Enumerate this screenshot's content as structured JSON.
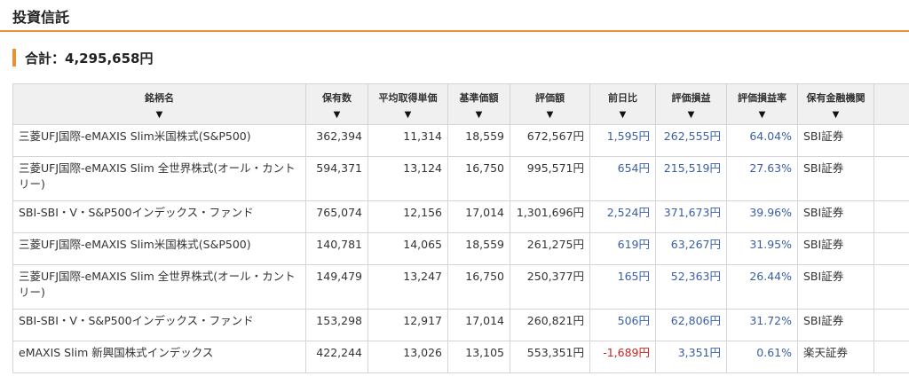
{
  "section": {
    "title": "投資信託"
  },
  "total": {
    "label": "合計：",
    "value": "4,295,658円"
  },
  "colors": {
    "accent": "#e8913a",
    "positive": "#3a5fa5",
    "negative": "#cc2222",
    "header_bg": "#f0f0f0"
  },
  "table": {
    "sort_icon": "sort-down-triangle",
    "sort_glyph": "▼",
    "headers": [
      "銘柄名",
      "保有数",
      "平均取得単価",
      "基準価額",
      "評価額",
      "前日比",
      "評価損益",
      "評価損益率",
      "保有金融機関"
    ],
    "rows": [
      {
        "name": "三菱UFJ国際-eMAXIS Slim米国株式(S&P500)",
        "holdings": "362,394",
        "avg_cost": "11,314",
        "base_price": "18,559",
        "value": "672,567円",
        "day_change": "1,595円",
        "day_sign": "pos",
        "pl": "262,555円",
        "pl_rate": "64.04%",
        "institution": "SBI証券"
      },
      {
        "name": "三菱UFJ国際-eMAXIS Slim 全世界株式(オール・カントリー)",
        "holdings": "594,371",
        "avg_cost": "13,124",
        "base_price": "16,750",
        "value": "995,571円",
        "day_change": "654円",
        "day_sign": "pos",
        "pl": "215,519円",
        "pl_rate": "27.63%",
        "institution": "SBI証券"
      },
      {
        "name": "SBI-SBI・V・S&P500インデックス・ファンド",
        "holdings": "765,074",
        "avg_cost": "12,156",
        "base_price": "17,014",
        "value": "1,301,696円",
        "day_change": "2,524円",
        "day_sign": "pos",
        "pl": "371,673円",
        "pl_rate": "39.96%",
        "institution": "SBI証券"
      },
      {
        "name": "三菱UFJ国際-eMAXIS Slim米国株式(S&P500)",
        "holdings": "140,781",
        "avg_cost": "14,065",
        "base_price": "18,559",
        "value": "261,275円",
        "day_change": "619円",
        "day_sign": "pos",
        "pl": "63,267円",
        "pl_rate": "31.95%",
        "institution": "SBI証券"
      },
      {
        "name": "三菱UFJ国際-eMAXIS Slim 全世界株式(オール・カントリー)",
        "holdings": "149,479",
        "avg_cost": "13,247",
        "base_price": "16,750",
        "value": "250,377円",
        "day_change": "165円",
        "day_sign": "pos",
        "pl": "52,363円",
        "pl_rate": "26.44%",
        "institution": "SBI証券"
      },
      {
        "name": "SBI-SBI・V・S&P500インデックス・ファンド",
        "holdings": "153,298",
        "avg_cost": "12,917",
        "base_price": "17,014",
        "value": "260,821円",
        "day_change": "506円",
        "day_sign": "pos",
        "pl": "62,806円",
        "pl_rate": "31.72%",
        "institution": "SBI証券"
      },
      {
        "name": "eMAXIS Slim 新興国株式インデックス",
        "holdings": "422,244",
        "avg_cost": "13,026",
        "base_price": "13,105",
        "value": "553,351円",
        "day_change": "-1,689円",
        "day_sign": "neg",
        "pl": "3,351円",
        "pl_rate": "0.61%",
        "institution": "楽天証券"
      }
    ]
  }
}
